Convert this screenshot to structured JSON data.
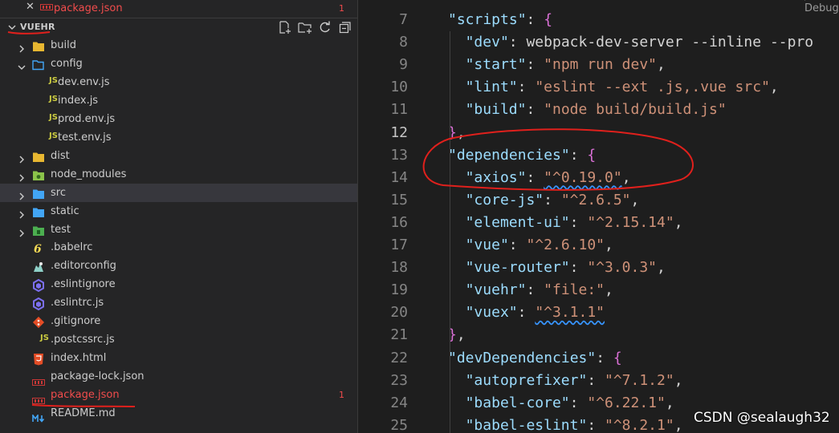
{
  "open_editors": [
    {
      "close_icon": "✕",
      "name": "package.json",
      "badge": "1"
    }
  ],
  "explorer": {
    "title": "VUEHR",
    "actions": [
      "new-file-icon",
      "new-folder-icon",
      "refresh-icon",
      "collapse-all-icon"
    ],
    "tree": [
      {
        "name": "build",
        "kind": "folder",
        "expanded": false
      },
      {
        "name": "config",
        "kind": "folder",
        "expanded": true
      },
      {
        "name": "dev.env.js",
        "kind": "js"
      },
      {
        "name": "index.js",
        "kind": "js"
      },
      {
        "name": "prod.env.js",
        "kind": "js"
      },
      {
        "name": "test.env.js",
        "kind": "js"
      },
      {
        "name": "dist",
        "kind": "folder",
        "expanded": false
      },
      {
        "name": "node_modules",
        "kind": "folder",
        "expanded": false
      },
      {
        "name": "src",
        "kind": "folder",
        "expanded": false,
        "selected": true
      },
      {
        "name": "static",
        "kind": "folder",
        "expanded": false
      },
      {
        "name": "test",
        "kind": "folder",
        "expanded": false
      },
      {
        "name": ".babelrc",
        "kind": "babel"
      },
      {
        "name": ".editorconfig",
        "kind": "editorconfig"
      },
      {
        "name": ".eslintignore",
        "kind": "eslint"
      },
      {
        "name": ".eslintrc.js",
        "kind": "eslint"
      },
      {
        "name": ".gitignore",
        "kind": "git"
      },
      {
        "name": ".postcssrc.js",
        "kind": "js"
      },
      {
        "name": "index.html",
        "kind": "html"
      },
      {
        "name": "package-lock.json",
        "kind": "json"
      },
      {
        "name": "package.json",
        "kind": "json",
        "error": true,
        "badge": "1"
      },
      {
        "name": "README.md",
        "kind": "md"
      }
    ]
  },
  "editor": {
    "codelens": "▷ Debug",
    "active_line": "12",
    "lines": [
      {
        "n": "7",
        "code": "\"scripts\": {"
      },
      {
        "n": "8",
        "code": "\"dev\": \"webpack-dev-server --inline --pro"
      },
      {
        "n": "9",
        "code": "\"start\": \"npm run dev\","
      },
      {
        "n": "10",
        "code": "\"lint\": \"eslint --ext .js,.vue src\","
      },
      {
        "n": "11",
        "code": "\"build\": \"node build/build.js\""
      },
      {
        "n": "12",
        "code": "},"
      },
      {
        "n": "13",
        "code": "\"dependencies\": {"
      },
      {
        "n": "14",
        "code": "\"axios\": \"^0.19.0\","
      },
      {
        "n": "15",
        "code": "\"core-js\": \"^2.6.5\","
      },
      {
        "n": "16",
        "code": "\"element-ui\": \"^2.15.14\","
      },
      {
        "n": "17",
        "code": "\"vue\": \"^2.6.10\","
      },
      {
        "n": "18",
        "code": "\"vue-router\": \"^3.0.3\","
      },
      {
        "n": "19",
        "code": "\"vuehr\": \"file:\","
      },
      {
        "n": "20",
        "code": "\"vuex\": \"^3.1.1\""
      },
      {
        "n": "21",
        "code": "},"
      },
      {
        "n": "22",
        "code": "\"devDependencies\": {"
      },
      {
        "n": "23",
        "code": "\"autoprefixer\": \"^7.1.2\","
      },
      {
        "n": "24",
        "code": "\"babel-core\": \"^6.22.1\","
      },
      {
        "n": "25",
        "code": "\"babel-eslint\": \"^8.2.1\","
      }
    ]
  },
  "watermark": "CSDN @sealaugh32",
  "colors": {
    "sidebar_bg": "#252526",
    "editor_bg": "#1e1e1e",
    "error": "#f14c4c",
    "annotation": "#e0201c",
    "key": "#9cdcfe",
    "string": "#ce9178",
    "bracket_outer": "#da70d6",
    "bracket_inner": "#ffd700"
  }
}
